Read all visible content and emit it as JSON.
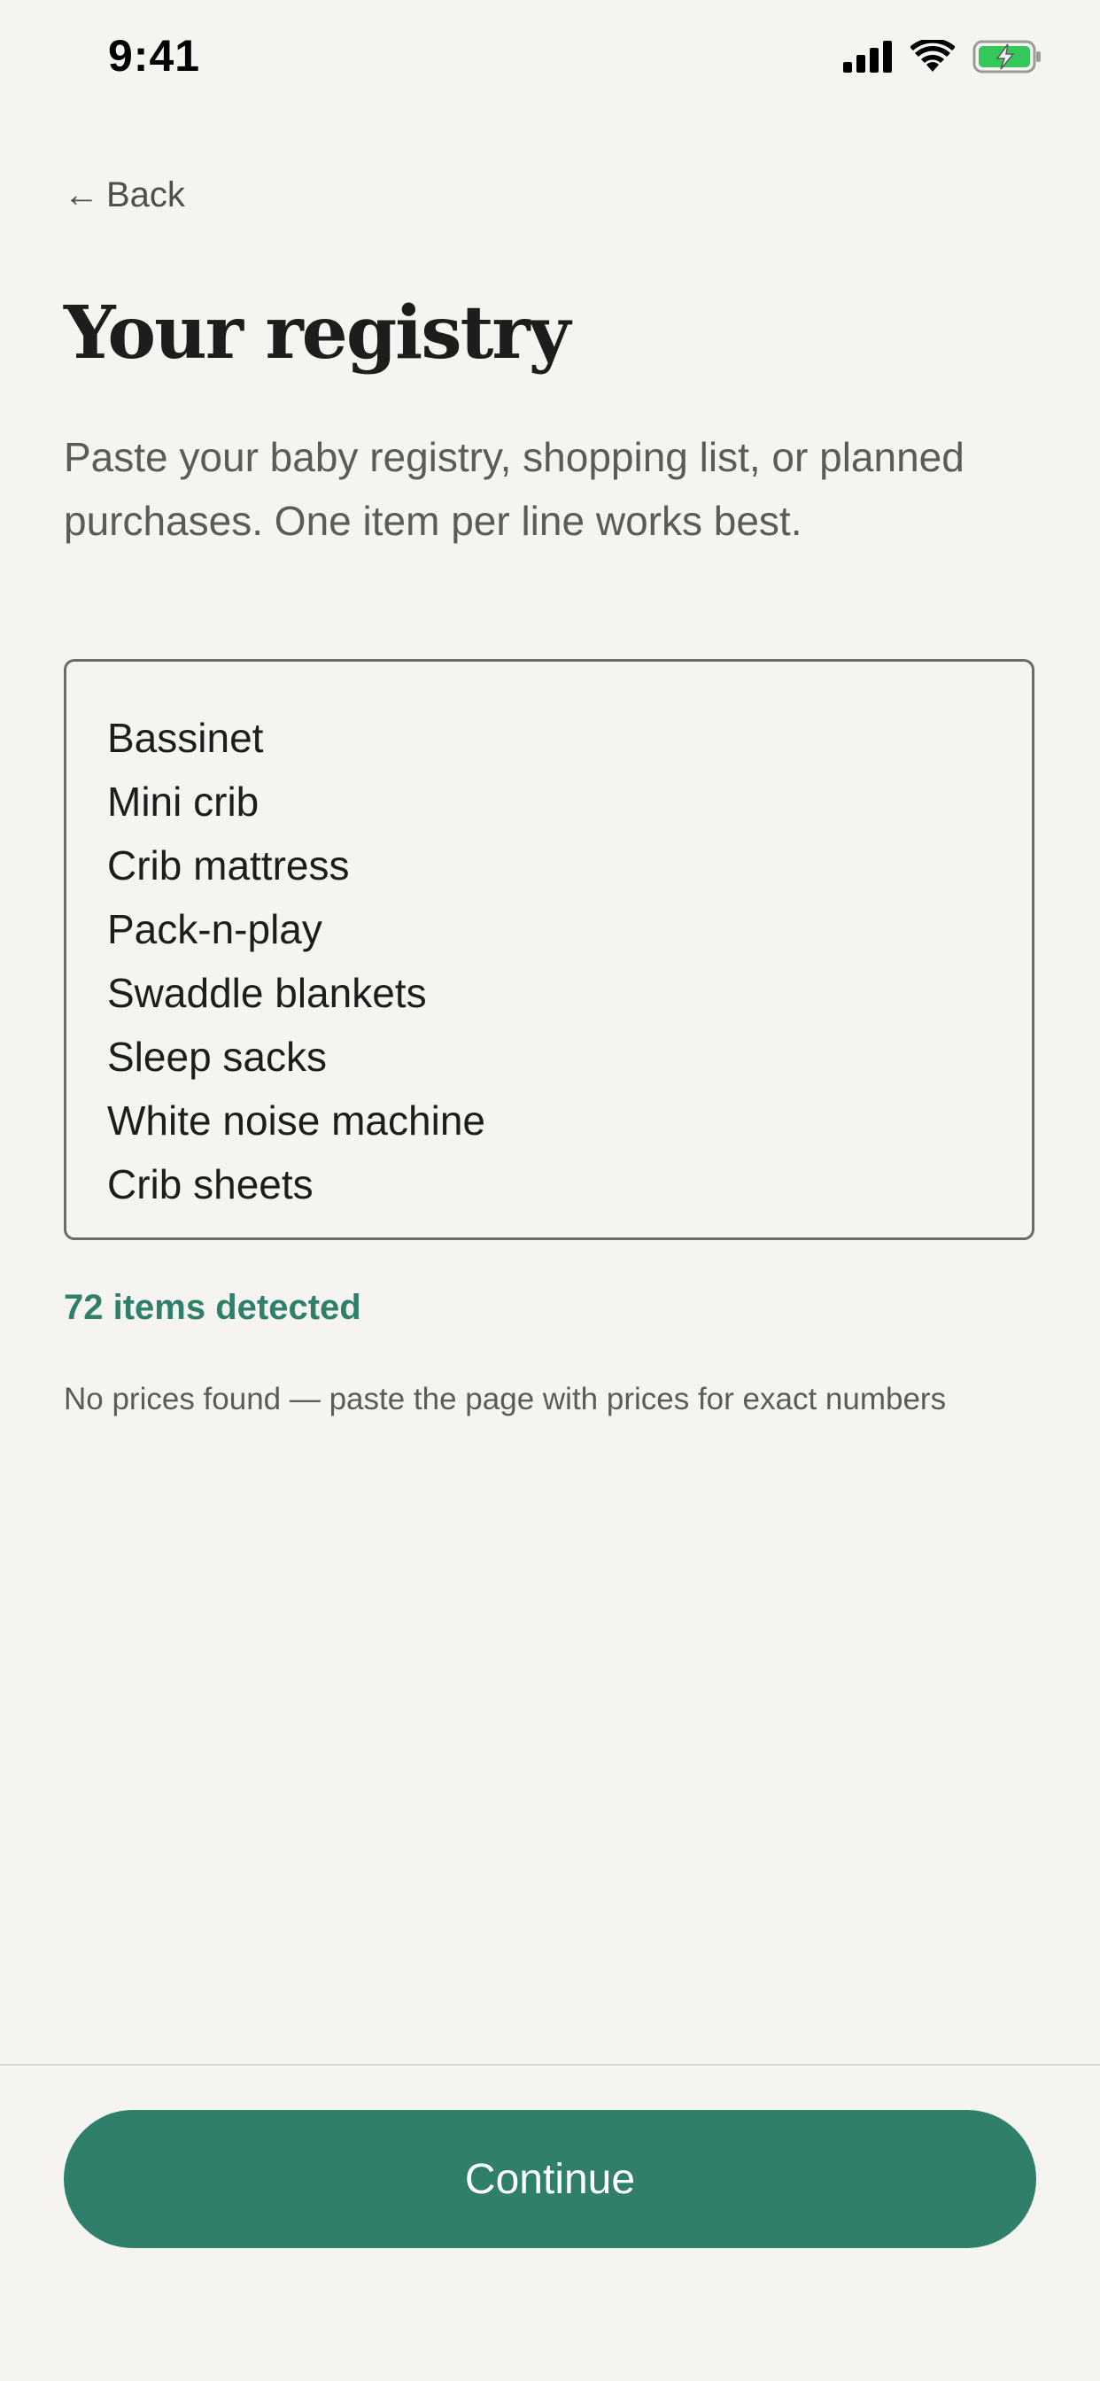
{
  "status_bar": {
    "time": "9:41"
  },
  "nav": {
    "back_arrow": "←",
    "back_label": "Back"
  },
  "header": {
    "title": "Your registry",
    "description": "Paste your baby registry, shopping list, or planned purchases. One item per line works best."
  },
  "registry": {
    "items": [
      "Bassinet",
      "Mini crib",
      "Crib mattress",
      "Pack-n-play",
      "Swaddle blankets",
      "Sleep sacks",
      "White noise machine",
      "Crib sheets"
    ]
  },
  "summary": {
    "items_detected": "72 items detected",
    "price_note": "No prices found — paste the page with prices for exact numbers"
  },
  "footer": {
    "continue_label": "Continue"
  },
  "colors": {
    "background": "#f5f4f1",
    "accent": "#2f7f6a",
    "battery_green": "#34c759"
  },
  "icons": [
    "signal-icon",
    "wifi-icon",
    "battery-charging-icon",
    "arrow-left-icon"
  ]
}
